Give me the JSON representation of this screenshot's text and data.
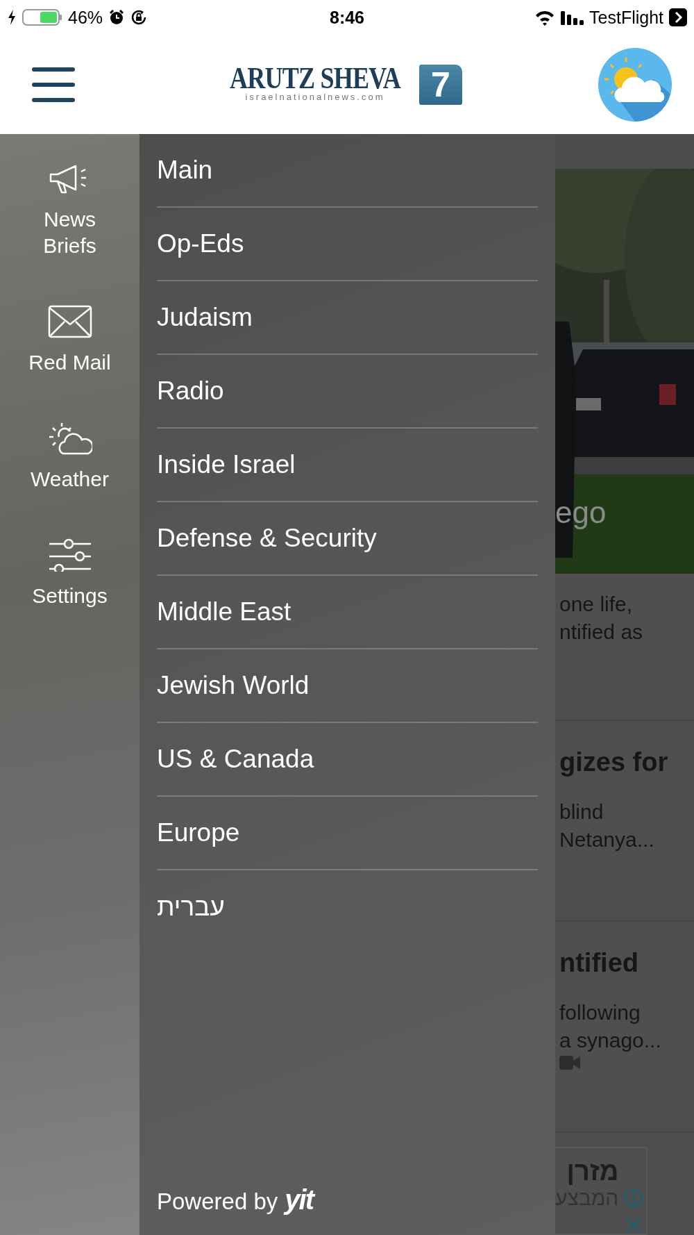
{
  "status_bar": {
    "battery": "46%",
    "time": "8:46",
    "carrier": "TestFlight"
  },
  "header": {
    "logo": {
      "title": "ARUTZ SHEVA",
      "subtitle": "israelnationalnews.com",
      "badge": "7"
    }
  },
  "rail": {
    "items": [
      {
        "kind": "megaphone",
        "label": "News Briefs"
      },
      {
        "kind": "mail",
        "label": "Red Mail"
      },
      {
        "kind": "weather",
        "label": "Weather"
      },
      {
        "kind": "settings",
        "label": "Settings"
      }
    ]
  },
  "menu": {
    "items": [
      {
        "label": "Main"
      },
      {
        "label": "Op-Eds"
      },
      {
        "label": "Judaism"
      },
      {
        "label": "Radio"
      },
      {
        "label": "Inside Israel"
      },
      {
        "label": "Defense & Security"
      },
      {
        "label": "Middle East"
      },
      {
        "label": "Jewish World"
      },
      {
        "label": "US & Canada"
      },
      {
        "label": "Europe"
      },
      {
        "label": "עברית"
      }
    ],
    "footer": {
      "text": "Powered by",
      "brand": "yit"
    }
  },
  "backdrop": {
    "photo": {
      "kind": "picture",
      "caption": "ego"
    },
    "stories": [
      {
        "lines": [
          "one life,",
          "ntified as"
        ],
        "has_video": false
      },
      {
        "title": "gizes for",
        "lines": [
          "blind",
          "Netanya..."
        ],
        "has_video": false
      },
      {
        "title": "ntified",
        "lines": [
          "following",
          "a synago..."
        ],
        "has_video": true
      }
    ],
    "ad": {
      "title": "מזרן",
      "text": "המבצע"
    }
  }
}
